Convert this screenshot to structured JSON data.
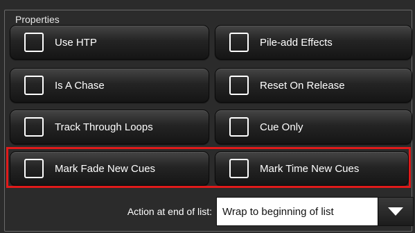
{
  "properties": {
    "title": "Properties",
    "options": [
      {
        "label": "Use HTP",
        "checked": false
      },
      {
        "label": "Pile-add Effects",
        "checked": false
      },
      {
        "label": "Is A Chase",
        "checked": false
      },
      {
        "label": "Reset On Release",
        "checked": false
      },
      {
        "label": "Track Through Loops",
        "checked": false
      },
      {
        "label": "Cue Only",
        "checked": false
      },
      {
        "label": "Mark Fade New Cues",
        "checked": false
      },
      {
        "label": "Mark Time New Cues",
        "checked": false
      }
    ]
  },
  "action": {
    "label": "Action at end of list:",
    "value": "Wrap to beginning of list",
    "arrow_icon": "triangle-down-icon"
  },
  "colors": {
    "background": "#2b2b2b",
    "highlight": "#e01a1a",
    "button_text": "#ffffff"
  }
}
